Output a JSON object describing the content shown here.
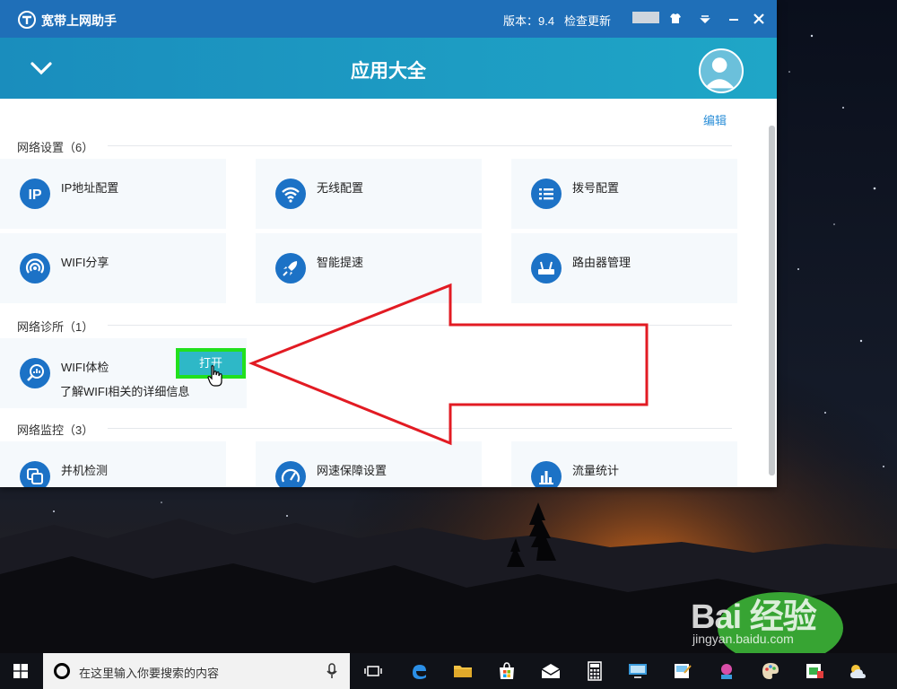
{
  "window": {
    "app_name": "宽带上网助手",
    "version_label": "版本：9.4",
    "check_update_label": "检查更新",
    "header_title": "应用大全",
    "edit_label": "编辑"
  },
  "sections": [
    {
      "title": "网络设置（6）",
      "items": [
        {
          "label": "IP地址配置",
          "icon": "ip-icon"
        },
        {
          "label": "无线配置",
          "icon": "wifi-icon"
        },
        {
          "label": "拨号配置",
          "icon": "dialup-icon"
        },
        {
          "label": "WIFI分享",
          "icon": "hotspot-icon"
        },
        {
          "label": "智能提速",
          "icon": "rocket-icon"
        },
        {
          "label": "路由器管理",
          "icon": "router-icon"
        }
      ]
    },
    {
      "title": "网络诊所（1）",
      "items": [
        {
          "label": "WIFI体检",
          "icon": "wifi-checkup-icon",
          "description": "了解WIFI相关的详细信息",
          "action_label": "打开"
        }
      ]
    },
    {
      "title": "网络监控（3）",
      "items": [
        {
          "label": "并机检测",
          "icon": "multi-device-icon"
        },
        {
          "label": "网速保障设置",
          "icon": "speedometer-icon"
        },
        {
          "label": "流量统计",
          "icon": "bar-chart-icon"
        }
      ]
    }
  ],
  "taskbar": {
    "search_placeholder": "在这里输入你要搜索的内容",
    "apps": [
      "task-view-icon",
      "edge-icon",
      "file-explorer-icon",
      "store-icon",
      "mail-icon",
      "calculator-icon",
      "remote-desktop-icon",
      "paint-icon",
      "network-icon",
      "palette-icon",
      "app-icon",
      "weather-icon"
    ]
  },
  "watermark": {
    "main": "Bai 经验",
    "sub": "jingyan.baidu.com"
  },
  "colors": {
    "titlebar": "#1f6fb8",
    "header": "#1fa6c7",
    "icon_blue": "#1c72c6",
    "open_button": "#2eb8c7",
    "highlight_green": "#22e01d",
    "annotation_red": "#e21b23"
  }
}
